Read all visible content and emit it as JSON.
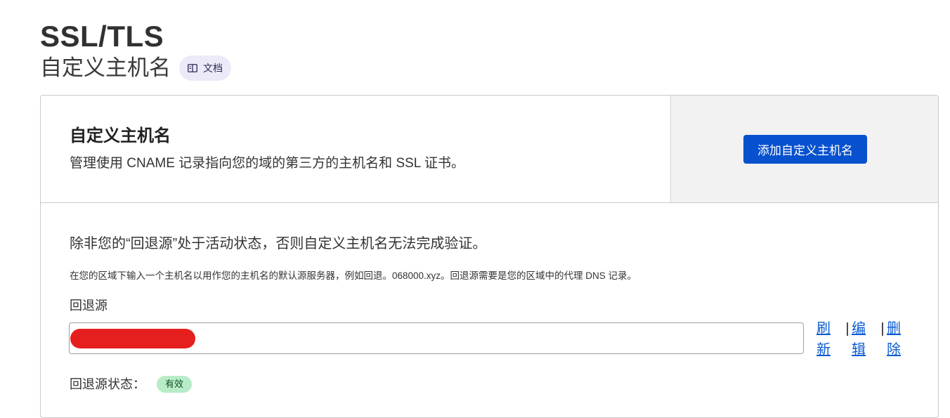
{
  "page": {
    "title": "SSL/TLS",
    "subtitle": "自定义主机名",
    "docs_label": "文档",
    "docs_icon": "book-icon"
  },
  "card": {
    "title": "自定义主机名",
    "description": "管理使用 CNAME 记录指向您的域的第三方的主机名和 SSL 证书。",
    "add_button_label": "添加自定义主机名",
    "notice": "除非您的“回退源”处于活动状态，否则自定义主机名无法完成验证。",
    "help_text": "在您的区域下输入一个主机名以用作您的主机名的默认源服务器，例如回退。068000.xyz。回退源需要是您的区域中的代理 DNS 记录。",
    "fallback_label": "回退源",
    "fallback_value": "",
    "actions": {
      "refresh": "刷新",
      "edit": "编辑",
      "delete": "删除",
      "separator": "|"
    },
    "status_label": "回退源状态：",
    "status_value": "有效"
  },
  "colors": {
    "primary": "#0751cf",
    "link": "#0b5bd3",
    "status_bg": "#b7ecc8",
    "redaction": "#e51e1e"
  }
}
